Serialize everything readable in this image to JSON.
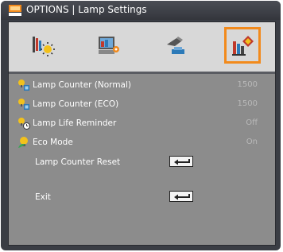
{
  "window": {
    "title": "OPTIONS | Lamp Settings"
  },
  "tabs": [
    {
      "name": "image-settings-icon",
      "active": false
    },
    {
      "name": "display-settings-icon",
      "active": false
    },
    {
      "name": "setup-icon",
      "active": false
    },
    {
      "name": "options-icon",
      "active": true
    }
  ],
  "items": [
    {
      "label": "Lamp Counter (Normal)",
      "value": "1500"
    },
    {
      "label": "Lamp Counter (ECO)",
      "value": "1500"
    },
    {
      "label": "Lamp Life Reminder",
      "value": "Off"
    },
    {
      "label": "Eco Mode",
      "value": "On"
    },
    {
      "label": "Lamp Counter Reset",
      "value": ""
    },
    {
      "label": "Exit",
      "value": ""
    }
  ],
  "colors": {
    "accent": "#f28a1c",
    "panel": "#8c8c8c",
    "background": "#3a3d44"
  }
}
